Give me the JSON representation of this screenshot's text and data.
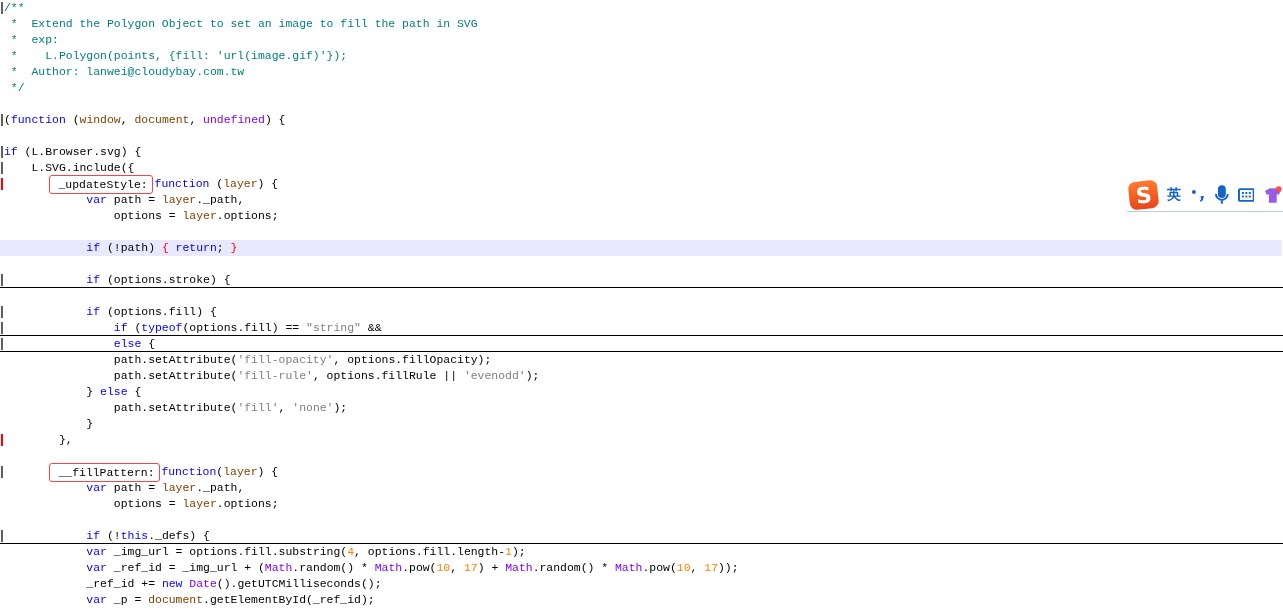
{
  "editor": {
    "lines": [
      {
        "modified": true,
        "tokens": [
          {
            "text": "/**",
            "kind": "comment"
          }
        ]
      },
      {
        "tokens": [
          {
            "text": " *  Extend the Polygon Object to set an image to fill the path in SVG",
            "kind": "comment"
          }
        ]
      },
      {
        "tokens": [
          {
            "text": " *  exp:",
            "kind": "comment"
          }
        ]
      },
      {
        "tokens": [
          {
            "text": " *    L.Polygon(points, {fill: 'url(image.gif)'});",
            "kind": "comment"
          }
        ]
      },
      {
        "tokens": [
          {
            "text": " *  Author: lanwei@cloudybay.com.tw",
            "kind": "comment"
          }
        ]
      },
      {
        "tokens": [
          {
            "text": " */",
            "kind": "comment"
          }
        ]
      },
      {
        "gap_before": true,
        "modified": true,
        "tokens": [
          {
            "text": "(",
            "kind": "plain"
          },
          {
            "text": "function",
            "kind": "keyword"
          },
          {
            "text": " (",
            "kind": "plain"
          },
          {
            "text": "window",
            "kind": "param"
          },
          {
            "text": ", ",
            "kind": "plain"
          },
          {
            "text": "document",
            "kind": "param"
          },
          {
            "text": ", ",
            "kind": "plain"
          },
          {
            "text": "undefined",
            "kind": "builtin"
          },
          {
            "text": ") {",
            "kind": "plain"
          }
        ]
      },
      {
        "gap_before": true,
        "modified": true,
        "tokens": [
          {
            "text": "if",
            "kind": "keyword"
          },
          {
            "text": " (L.Browser.svg) {",
            "kind": "plain"
          }
        ]
      },
      {
        "modified": true,
        "tokens": [
          {
            "text": "    L.SVG.include({",
            "kind": "plain"
          }
        ]
      },
      {
        "flagged": true,
        "tokens": [
          {
            "text": "        _updateStyle:",
            "kind": "plain",
            "boxed": true
          },
          {
            "text": " function",
            "kind": "keyword"
          },
          {
            "text": " (",
            "kind": "plain"
          },
          {
            "text": "layer",
            "kind": "param"
          },
          {
            "text": ") {",
            "kind": "plain"
          }
        ]
      },
      {
        "tokens": [
          {
            "text": "            var",
            "kind": "keyword"
          },
          {
            "text": " path = ",
            "kind": "plain"
          },
          {
            "text": "layer",
            "kind": "param"
          },
          {
            "text": "._path,",
            "kind": "plain"
          }
        ]
      },
      {
        "tokens": [
          {
            "text": "                options = ",
            "kind": "plain"
          },
          {
            "text": "layer",
            "kind": "param"
          },
          {
            "text": ".options;",
            "kind": "plain"
          }
        ]
      },
      {
        "gap_before": true,
        "current": true,
        "tokens": [
          {
            "text": "            if",
            "kind": "keyword"
          },
          {
            "text": " (!path) ",
            "kind": "plain"
          },
          {
            "text": "{",
            "kind": "brace"
          },
          {
            "text": " return",
            "kind": "keyword"
          },
          {
            "text": "; ",
            "kind": "plain"
          },
          {
            "text": "}",
            "kind": "brace"
          }
        ]
      },
      {
        "gap_before": true,
        "modified": true,
        "folded": true,
        "tokens": [
          {
            "text": "            if",
            "kind": "keyword"
          },
          {
            "text": " (options.stroke) {",
            "kind": "plain"
          }
        ]
      },
      {
        "gap_before": true,
        "modified": true,
        "tokens": [
          {
            "text": "            if",
            "kind": "keyword"
          },
          {
            "text": " (options.fill) {",
            "kind": "plain"
          }
        ]
      },
      {
        "modified": true,
        "folded": true,
        "tokens": [
          {
            "text": "                if",
            "kind": "keyword"
          },
          {
            "text": " (",
            "kind": "plain"
          },
          {
            "text": "typeof",
            "kind": "keyword"
          },
          {
            "text": "(options.fill) == ",
            "kind": "plain"
          },
          {
            "text": "\"string\"",
            "kind": "string"
          },
          {
            "text": " &&",
            "kind": "plain"
          }
        ]
      },
      {
        "modified": true,
        "folded": true,
        "tokens": [
          {
            "text": "                else",
            "kind": "keyword"
          },
          {
            "text": " {",
            "kind": "plain"
          }
        ]
      },
      {
        "tokens": [
          {
            "text": "                path.setAttribute(",
            "kind": "plain"
          },
          {
            "text": "'fill-opacity'",
            "kind": "string"
          },
          {
            "text": ", options.fillOpacity);",
            "kind": "plain"
          }
        ]
      },
      {
        "tokens": [
          {
            "text": "                path.setAttribute(",
            "kind": "plain"
          },
          {
            "text": "'fill-rule'",
            "kind": "string"
          },
          {
            "text": ", options.fillRule || ",
            "kind": "plain"
          },
          {
            "text": "'evenodd'",
            "kind": "string"
          },
          {
            "text": ");",
            "kind": "plain"
          }
        ]
      },
      {
        "tokens": [
          {
            "text": "            } ",
            "kind": "plain"
          },
          {
            "text": "else",
            "kind": "keyword"
          },
          {
            "text": " {",
            "kind": "plain"
          }
        ]
      },
      {
        "tokens": [
          {
            "text": "                path.setAttribute(",
            "kind": "plain"
          },
          {
            "text": "'fill'",
            "kind": "string"
          },
          {
            "text": ", ",
            "kind": "plain"
          },
          {
            "text": "'none'",
            "kind": "string"
          },
          {
            "text": ");",
            "kind": "plain"
          }
        ]
      },
      {
        "tokens": [
          {
            "text": "            }",
            "kind": "plain"
          }
        ]
      },
      {
        "flagged": true,
        "tokens": [
          {
            "text": "        },",
            "kind": "plain"
          }
        ]
      },
      {
        "gap_before": true,
        "modified": true,
        "tokens": [
          {
            "text": "        __fillPattern:",
            "kind": "plain",
            "boxed": true
          },
          {
            "text": " function",
            "kind": "keyword"
          },
          {
            "text": "(",
            "kind": "plain"
          },
          {
            "text": "layer",
            "kind": "param"
          },
          {
            "text": ") {",
            "kind": "plain"
          }
        ]
      },
      {
        "tokens": [
          {
            "text": "            var",
            "kind": "keyword"
          },
          {
            "text": " path = ",
            "kind": "plain"
          },
          {
            "text": "layer",
            "kind": "param"
          },
          {
            "text": "._path,",
            "kind": "plain"
          }
        ]
      },
      {
        "tokens": [
          {
            "text": "                options = ",
            "kind": "plain"
          },
          {
            "text": "layer",
            "kind": "param"
          },
          {
            "text": ".options;",
            "kind": "plain"
          }
        ]
      },
      {
        "gap_before": true,
        "modified": true,
        "folded": true,
        "tokens": [
          {
            "text": "            if",
            "kind": "keyword"
          },
          {
            "text": " (!",
            "kind": "plain"
          },
          {
            "text": "this",
            "kind": "keyword"
          },
          {
            "text": "._defs) {",
            "kind": "plain"
          }
        ]
      },
      {
        "tokens": [
          {
            "text": "            var",
            "kind": "keyword"
          },
          {
            "text": " _img_url = options.fill.substring(",
            "kind": "plain"
          },
          {
            "text": "4",
            "kind": "number"
          },
          {
            "text": ", options.fill.length-",
            "kind": "plain"
          },
          {
            "text": "1",
            "kind": "number"
          },
          {
            "text": ");",
            "kind": "plain"
          }
        ]
      },
      {
        "tokens": [
          {
            "text": "            var",
            "kind": "keyword"
          },
          {
            "text": " _ref_id = _img_url + (",
            "kind": "plain"
          },
          {
            "text": "Math",
            "kind": "builtin"
          },
          {
            "text": ".random() * ",
            "kind": "plain"
          },
          {
            "text": "Math",
            "kind": "builtin"
          },
          {
            "text": ".pow(",
            "kind": "plain"
          },
          {
            "text": "10",
            "kind": "number"
          },
          {
            "text": ", ",
            "kind": "plain"
          },
          {
            "text": "17",
            "kind": "number"
          },
          {
            "text": ") + ",
            "kind": "plain"
          },
          {
            "text": "Math",
            "kind": "builtin"
          },
          {
            "text": ".random() * ",
            "kind": "plain"
          },
          {
            "text": "Math",
            "kind": "builtin"
          },
          {
            "text": ".pow(",
            "kind": "plain"
          },
          {
            "text": "10",
            "kind": "number"
          },
          {
            "text": ", ",
            "kind": "plain"
          },
          {
            "text": "17",
            "kind": "number"
          },
          {
            "text": "));",
            "kind": "plain"
          }
        ]
      },
      {
        "tokens": [
          {
            "text": "            _ref_id += ",
            "kind": "plain"
          },
          {
            "text": "new",
            "kind": "keyword"
          },
          {
            "text": " Date",
            "kind": "builtin"
          },
          {
            "text": "().getUTCMilliseconds();",
            "kind": "plain"
          }
        ]
      },
      {
        "tokens": [
          {
            "text": "            var",
            "kind": "keyword"
          },
          {
            "text": " _p = ",
            "kind": "plain"
          },
          {
            "text": "document",
            "kind": "param"
          },
          {
            "text": ".getElementById(_ref_id);",
            "kind": "plain"
          }
        ]
      }
    ]
  },
  "ime_toolbar": {
    "logo": "S",
    "mode": "英"
  }
}
